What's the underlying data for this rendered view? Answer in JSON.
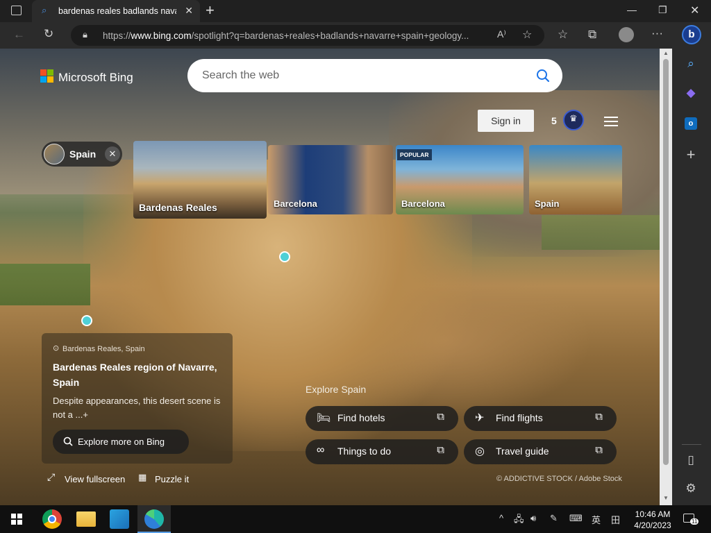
{
  "browser": {
    "tab_title": "bardenas reales badlands navarre",
    "url_host_prefix": "https://",
    "url_host": "www.bing.com",
    "url_rest": "/spotlight?q=bardenas+reales+badlands+navarre+spain+geology..."
  },
  "bing": {
    "logo_text": "Microsoft Bing",
    "search_placeholder": "Search the web",
    "sign_in": "Sign in",
    "rewards_count": "5",
    "chip_label": "Spain",
    "cards": [
      {
        "label": "Bardenas Reales",
        "badge": ""
      },
      {
        "label": "Barcelona",
        "badge": ""
      },
      {
        "label": "Barcelona",
        "badge": "POPULAR"
      },
      {
        "label": "Spain",
        "badge": ""
      }
    ],
    "info": {
      "location": "Bardenas Reales, Spain",
      "title": "Bardenas Reales region of Navarre, Spain",
      "description": "Despite appearances, this desert scene is not a ...+",
      "explore_button": "Explore more on Bing"
    },
    "view_fullscreen": "View fullscreen",
    "puzzle_it": "Puzzle it",
    "explore_heading": "Explore Spain",
    "actions": [
      {
        "label": "Find hotels",
        "icon": "bed-icon"
      },
      {
        "label": "Find flights",
        "icon": "airplane-icon"
      },
      {
        "label": "Things to do",
        "icon": "binoculars-icon"
      },
      {
        "label": "Travel guide",
        "icon": "compass-icon"
      }
    ],
    "credit": "© ADDICTIVE STOCK / Adobe Stock"
  },
  "taskbar": {
    "time": "10:46 AM",
    "date": "4/20/2023",
    "ime": "英",
    "notification_count": "11"
  },
  "colors": {
    "accent": "#4fd0d6",
    "search_icon": "#1a73e8"
  }
}
